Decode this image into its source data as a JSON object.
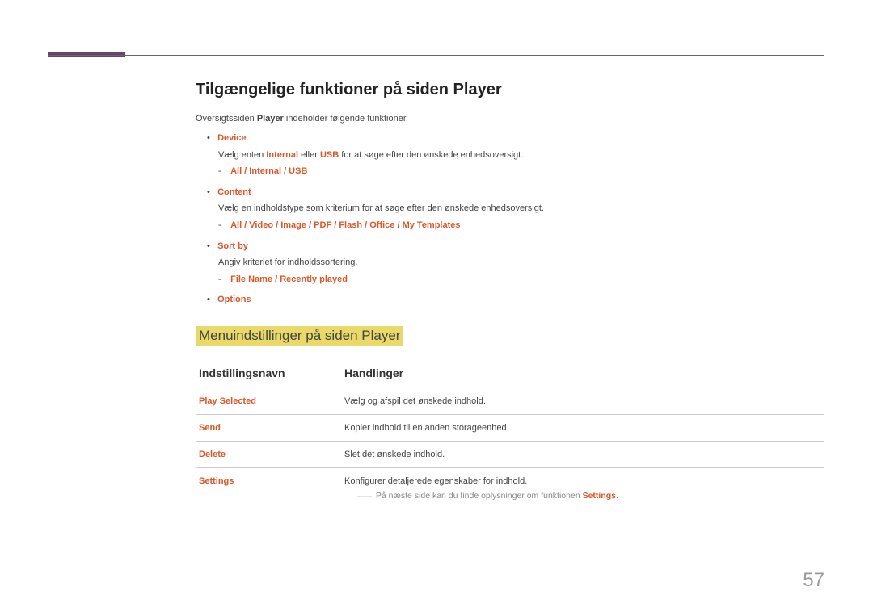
{
  "page": {
    "title": "Tilgængelige funktioner på siden Player",
    "intro_prefix": "Oversigtssiden ",
    "intro_bold": "Player",
    "intro_suffix": " indeholder følgende funktioner.",
    "page_number": "57"
  },
  "features": [
    {
      "label": "Device",
      "description_prefix": "Vælg enten ",
      "description_bold1": "Internal",
      "description_mid": " eller ",
      "description_bold2": "USB",
      "description_suffix": " for at søge efter den ønskede enhedsoversigt.",
      "sub": "All / Internal / USB"
    },
    {
      "label": "Content",
      "description": "Vælg en indholdstype som kriterium for at søge efter den ønskede enhedsoversigt.",
      "sub": "All / Video / Image / PDF / Flash / Office / My Templates"
    },
    {
      "label": "Sort by",
      "description": "Angiv kriteriet for indholdssortering.",
      "sub": "File Name / Recently played"
    },
    {
      "label": "Options"
    }
  ],
  "section": {
    "title": "Menuindstillinger på siden Player",
    "col1": "Indstillingsnavn",
    "col2": "Handlinger"
  },
  "table": [
    {
      "name": "Play Selected",
      "action": "Vælg og afspil det ønskede indhold."
    },
    {
      "name": "Send",
      "action": "Kopier indhold til en anden storageenhed."
    },
    {
      "name": "Delete",
      "action": "Slet det ønskede indhold."
    },
    {
      "name": "Settings",
      "action": "Konfigurer detaljerede egenskaber for indhold.",
      "note_prefix": "På næste side kan du finde oplysninger om funktionen ",
      "note_bold": "Settings",
      "note_suffix": "."
    }
  ]
}
